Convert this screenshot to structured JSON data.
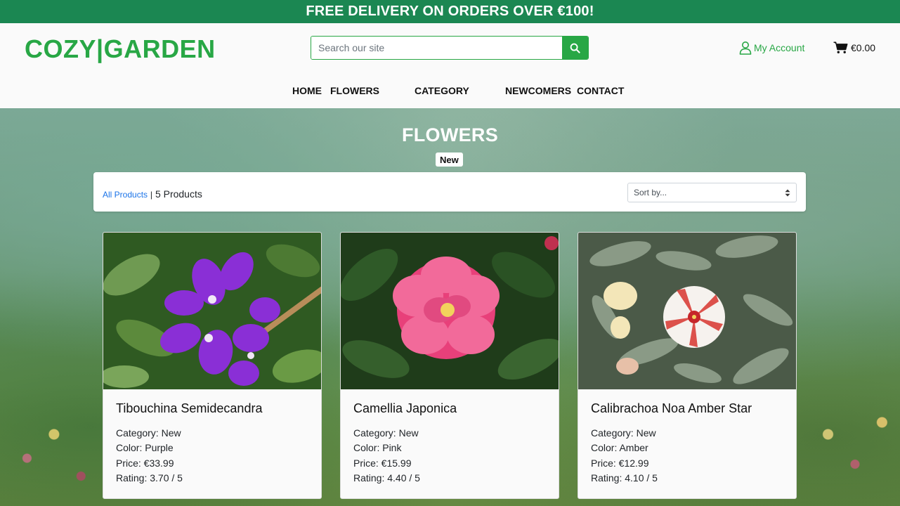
{
  "banner": {
    "text": "FREE DELIVERY ON ORDERS OVER €100!"
  },
  "header": {
    "logo": "COZY|GARDEN",
    "search_placeholder": "Search our site",
    "account_label": "My Account",
    "cart_total": "€0.00"
  },
  "nav": {
    "items": [
      {
        "label": "HOME"
      },
      {
        "label": "FLOWERS"
      },
      {
        "label": "CATEGORY"
      },
      {
        "label": "NEWCOMERS"
      },
      {
        "label": "CONTACT"
      }
    ]
  },
  "page": {
    "title": "FLOWERS",
    "badge": "New"
  },
  "filter": {
    "breadcrumb_link": "All Products",
    "separator": "|",
    "count": "5 Products",
    "sort_selected": "Sort by..."
  },
  "products": [
    {
      "name": "Tibouchina Semidecandra",
      "category": "Category: New",
      "color": "Color: Purple",
      "price": "Price: €33.99",
      "rating": "Rating: 3.70 / 5"
    },
    {
      "name": "Camellia Japonica",
      "category": "Category: New",
      "color": "Color: Pink",
      "price": "Price: €15.99",
      "rating": "Rating: 4.40 / 5"
    },
    {
      "name": "Calibrachoa Noa Amber Star",
      "category": "Category: New",
      "color": "Color: Amber",
      "price": "Price: €12.99",
      "rating": "Rating: 4.10 / 5"
    }
  ],
  "colors": {
    "brand_green": "#28a745",
    "banner_green": "#1b8752",
    "link_blue": "#1a73e8"
  },
  "icons": {
    "search": "search-icon",
    "account": "user-icon",
    "cart": "cart-icon",
    "sort": "sort-arrows-icon"
  }
}
